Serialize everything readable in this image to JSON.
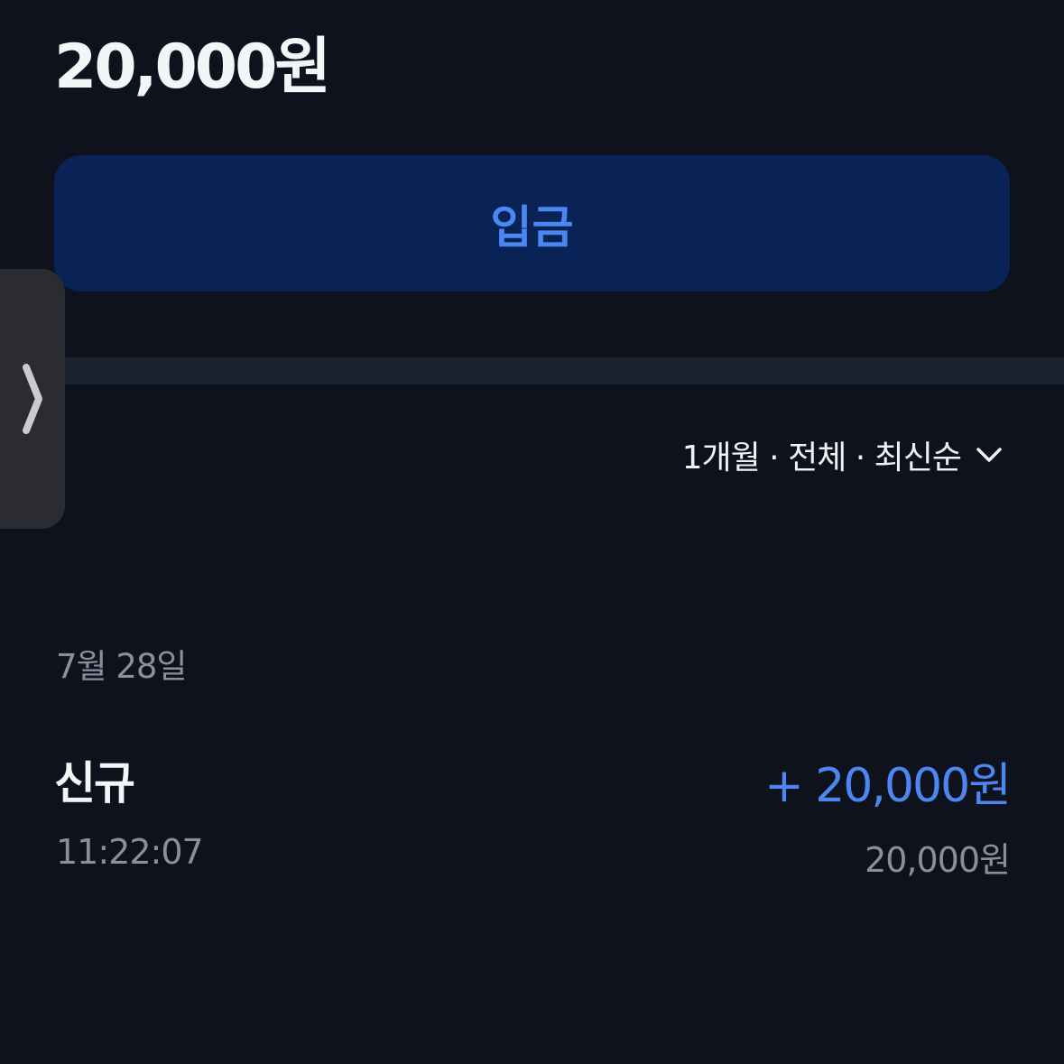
{
  "header": {
    "balance": "20,000원"
  },
  "actions": {
    "deposit_label": "입금"
  },
  "filter": {
    "label": "1개월 · 전체 · 최신순",
    "icon": "chevron-down-icon"
  },
  "side_handle": {
    "icon": "chevron-right-icon"
  },
  "transactions": [
    {
      "date": "7월 28일",
      "title": "신규",
      "time": "11:22:07",
      "amount": "+ 20,000원",
      "balance_after": "20,000원"
    }
  ],
  "colors": {
    "background": "#0e121d",
    "button_bg": "#0a2356",
    "accent": "#4c86f2",
    "muted_text": "#8a8f9c",
    "divider": "#1a2230",
    "handle_bg": "#2a2c31"
  }
}
